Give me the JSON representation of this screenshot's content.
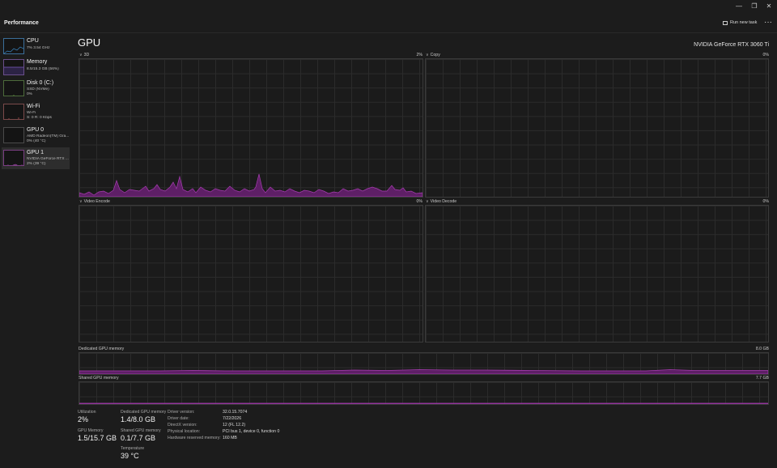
{
  "header": {
    "title": "Performance",
    "run_task_label": "Run new task",
    "more_label": "···"
  },
  "window": {
    "minimize": "—",
    "maximize": "❐",
    "close": "✕"
  },
  "sidebar": {
    "items": [
      {
        "name": "CPU",
        "sub1": "7% 3.54 GHz",
        "sub2": ""
      },
      {
        "name": "Memory",
        "sub1": "8.5/15.3 GB (56%)",
        "sub2": ""
      },
      {
        "name": "Disk 0 (C:)",
        "sub1": "SSD (NVMe)",
        "sub2": "0%"
      },
      {
        "name": "Wi-Fi",
        "sub1": "Wi-Fi",
        "sub2": "S: 0 R: 0 Kbps"
      },
      {
        "name": "GPU 0",
        "sub1": "AMD Radeon(TM) Gra...",
        "sub2": "0% (40 °C)"
      },
      {
        "name": "GPU 1",
        "sub1": "NVIDIA GeForce RTX ...",
        "sub2": "2% (39 °C)"
      }
    ]
  },
  "main": {
    "title": "GPU",
    "model": "NVIDIA GeForce RTX 3060 Ti",
    "graphs": {
      "three_d": {
        "label": "3D",
        "pct": "2%"
      },
      "copy": {
        "label": "Copy",
        "pct": "0%"
      },
      "video_encode": {
        "label": "Video Encode",
        "pct": "0%"
      },
      "video_decode": {
        "label": "Video Decode",
        "pct": "0%"
      },
      "dedicated": {
        "label": "Dedicated GPU memory",
        "max": "8.0 GB"
      },
      "shared": {
        "label": "Shared GPU memory",
        "max": "7.7 GB"
      }
    },
    "stats": {
      "utilization_label": "Utilization",
      "utilization": "2%",
      "dedicated_label": "Dedicated GPU memory",
      "dedicated": "1.4/8.0 GB",
      "gpu_mem_label": "GPU Memory",
      "gpu_mem": "1.5/15.7 GB",
      "shared_label": "Shared GPU memory",
      "shared": "0.1/7.7 GB",
      "temp_label": "Temperature",
      "temp": "39 °C"
    },
    "info": [
      {
        "label": "Driver version:",
        "value": "32.0.15.7074"
      },
      {
        "label": "Driver date:",
        "value": "7/22/2026"
      },
      {
        "label": "DirectX version:",
        "value": "12 (FL 12.2)"
      },
      {
        "label": "Physical location:",
        "value": "PCI bus 1, device 0, function 0"
      },
      {
        "label": "Hardware reserved memory:",
        "value": "160 MB"
      }
    ]
  },
  "colors": {
    "accent": "#a63cb0",
    "fill": "#5e1f66",
    "background": "#1c1c1c"
  }
}
